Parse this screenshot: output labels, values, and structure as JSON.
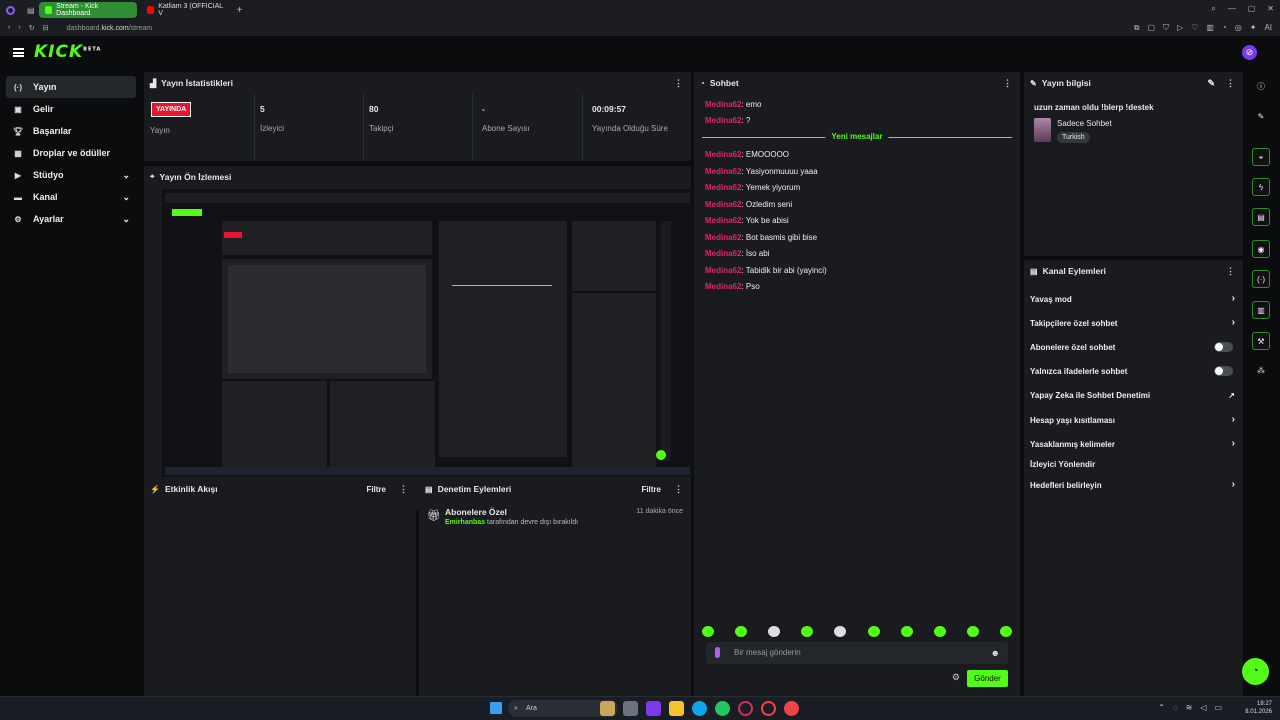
{
  "browser": {
    "tabs": [
      {
        "title": "Stream - Kick Dashboard",
        "active": true
      },
      {
        "title": "Katliam 3 (OFFICIAL V",
        "active": false
      }
    ],
    "url_prefix": "dashboard.",
    "url_domain": "kick.com",
    "url_path": "/stream",
    "ai_label": "AI"
  },
  "header": {
    "logo": "KICK",
    "logo_sup": "BETA"
  },
  "sidebar": {
    "items": [
      {
        "label": "Yayın",
        "icon": "broadcast-icon",
        "active": true
      },
      {
        "label": "Gelir",
        "icon": "money-icon"
      },
      {
        "label": "Başarılar",
        "icon": "trophy-icon"
      },
      {
        "label": "Droplar ve ödüller",
        "icon": "gift-icon"
      },
      {
        "label": "Stüdyo",
        "icon": "studio-icon",
        "expandable": true
      },
      {
        "label": "Kanal",
        "icon": "channel-icon",
        "expandable": true
      },
      {
        "label": "Ayarlar",
        "icon": "settings-icon",
        "expandable": true
      }
    ]
  },
  "stats": {
    "title": "Yayın İstatistikleri",
    "live_badge": "YAYINDA",
    "live_label": "Yayın",
    "viewers": {
      "value": "5",
      "label": "İzleyici"
    },
    "followers": {
      "value": "80",
      "label": "Takipçi"
    },
    "subs": {
      "value": "-",
      "label": "Abone Sayısı"
    },
    "duration": {
      "value": "00:09:57",
      "label": "Yayında Olduğu Süre"
    }
  },
  "preview": {
    "title": "Yayın Ön İzlemesi"
  },
  "activity": {
    "title": "Etkinlik Akışı",
    "filter": "Filtre"
  },
  "moderation": {
    "title": "Denetim Eylemleri",
    "filter": "Filtre",
    "entry_title": "Abonelere Özel",
    "entry_time": "11 dakika önce",
    "entry_user": "Emirhanbas",
    "entry_text": "tarafından devre dışı bırakıldı"
  },
  "chat": {
    "title": "Sohbet",
    "before": [
      {
        "user": "Medina62",
        "msg": ": emo"
      },
      {
        "user": "Medina62",
        "msg": ": ?"
      }
    ],
    "new_label": "Yeni mesajlar",
    "after": [
      {
        "user": "Medina62",
        "msg": ": EMOOOOO"
      },
      {
        "user": "Medina62",
        "msg": ": Yasiyonmuuuu yaaa"
      },
      {
        "user": "Medina62",
        "msg": ": Yemek yiyorum"
      },
      {
        "user": "Medina62",
        "msg": ": Ozledim seni"
      },
      {
        "user": "Medina62",
        "msg": ": Yok be abisi"
      },
      {
        "user": "Medina62",
        "msg": ": Bot basmis gibi bise"
      },
      {
        "user": "Medina62",
        "msg": ": İso abi"
      },
      {
        "user": "Medina62",
        "msg": ": Tabidik bir abi (yayinci)"
      },
      {
        "user": "Medina62",
        "msg": ": Pso"
      }
    ],
    "placeholder": "Bir mesaj gönderin",
    "send": "Gönder"
  },
  "stream_info": {
    "title": "Yayın bilgisi",
    "stream_title": "uzun zaman oldu !blerp !destek",
    "category": "Sadece Sohbet",
    "tag": "Turkish"
  },
  "channel_actions": {
    "title": "Kanal Eylemleri",
    "items": [
      {
        "label": "Yavaş mod",
        "control": "chevron"
      },
      {
        "label": "Takipçilere özel sohbet",
        "control": "chevron"
      },
      {
        "label": "Abonelere özel sohbet",
        "control": "toggle"
      },
      {
        "label": "Yalnızca ifadelerle sohbet",
        "control": "toggle"
      },
      {
        "label": "Yapay Zeka ile Sohbet Denetimi",
        "control": "external"
      },
      {
        "label": "Hesap yaşı kısıtlaması",
        "control": "chevron"
      },
      {
        "label": "Yasaklanmış kelimeler",
        "control": "chevron"
      },
      {
        "label": "İzleyici Yönlendir",
        "control": "none"
      },
      {
        "label": "Hedefleri belirleyin",
        "control": "chevron"
      }
    ]
  },
  "taskbar": {
    "search": "Ara",
    "time": "18:27",
    "date": "8.01.2026"
  },
  "colors": {
    "accent": "#53fc18",
    "live": "#e5162c",
    "panel": "#191b1f",
    "username": "#e0256d"
  }
}
